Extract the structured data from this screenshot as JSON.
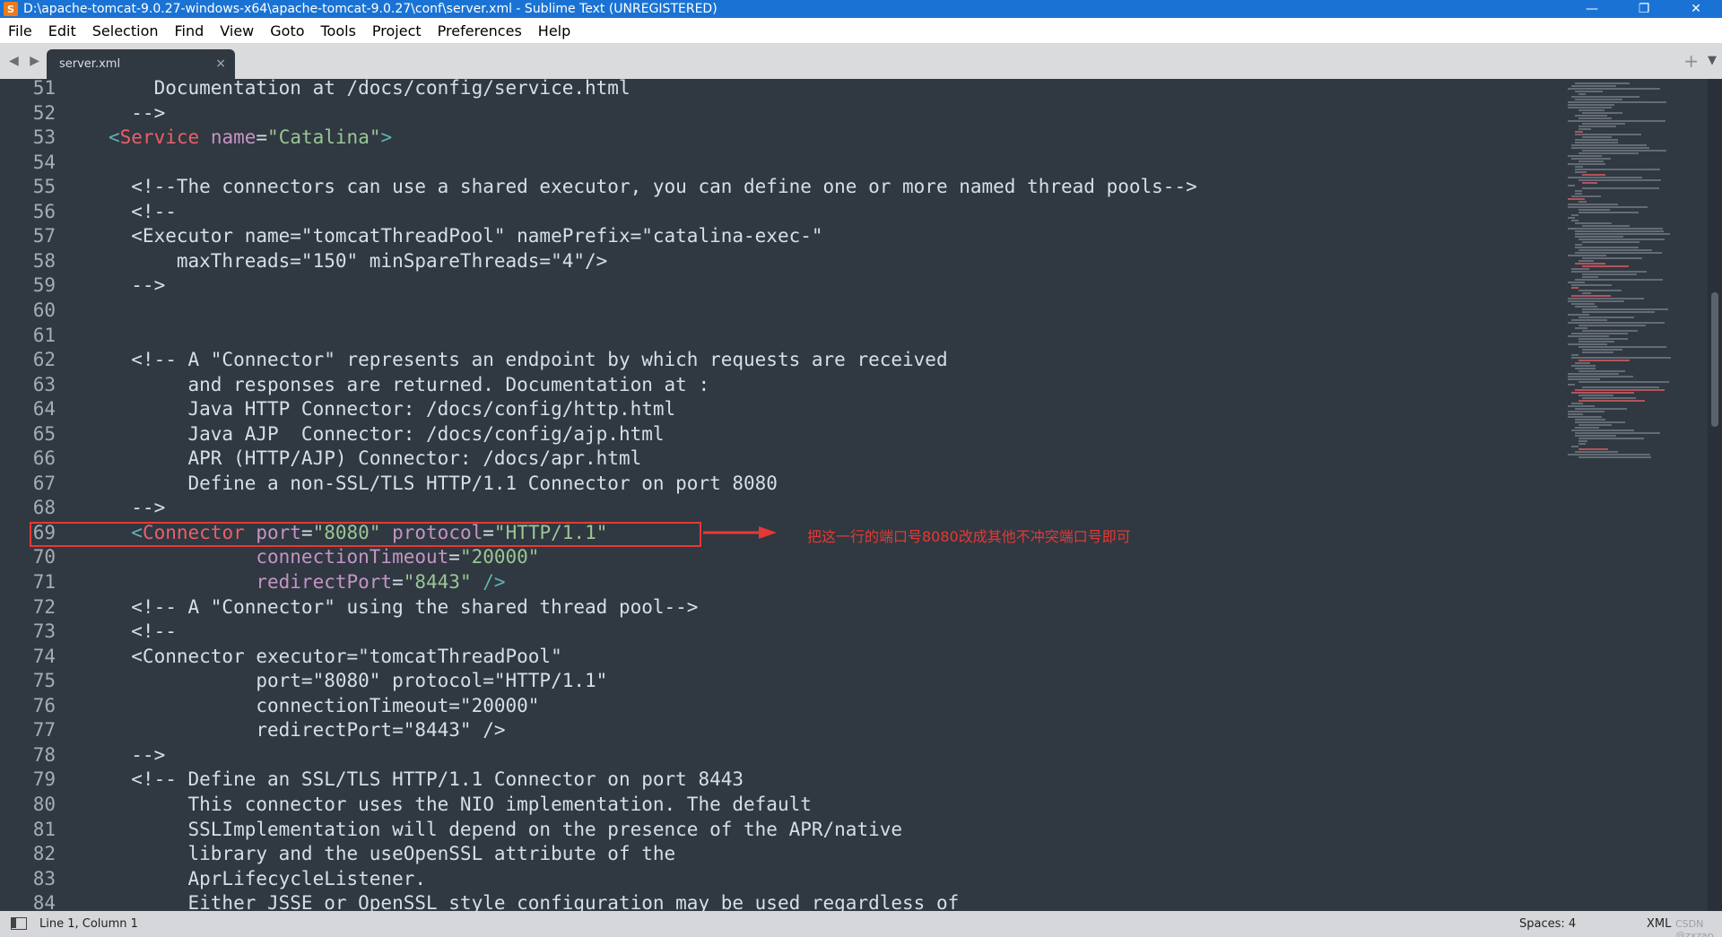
{
  "window": {
    "app_icon": "S",
    "title": "D:\\apache-tomcat-9.0.27-windows-x64\\apache-tomcat-9.0.27\\conf\\server.xml - Sublime Text (UNREGISTERED)",
    "minimize": "—",
    "restore": "❐",
    "close": "✕"
  },
  "menu": {
    "items": [
      "File",
      "Edit",
      "Selection",
      "Find",
      "View",
      "Goto",
      "Tools",
      "Project",
      "Preferences",
      "Help"
    ]
  },
  "tabs": {
    "nav": "◀ ▶",
    "active_tab": "server.xml",
    "close": "×",
    "new_tab": "+",
    "menu": "▼"
  },
  "editor": {
    "lines": [
      {
        "n": "51",
        "parts": [
          {
            "t": "    Documentation at /docs/config/service.html",
            "c": "c-comment"
          }
        ]
      },
      {
        "n": "52",
        "parts": [
          {
            "t": "  -->",
            "c": "c-comment"
          }
        ]
      },
      {
        "n": "53",
        "parts": [
          {
            "t": "<",
            "c": "c-punct"
          },
          {
            "t": "Service",
            "c": "c-tag"
          },
          {
            "t": " name",
            "c": "c-attr"
          },
          {
            "t": "=",
            "c": "c-plain"
          },
          {
            "t": "\"Catalina\"",
            "c": "c-str"
          },
          {
            "t": ">",
            "c": "c-punct"
          }
        ]
      },
      {
        "n": "54",
        "parts": [
          {
            "t": "",
            "c": "c-plain"
          }
        ]
      },
      {
        "n": "55",
        "parts": [
          {
            "t": "  <!--The connectors can use a shared executor, you can define one or more named thread pools-->",
            "c": "c-comment"
          }
        ]
      },
      {
        "n": "56",
        "parts": [
          {
            "t": "  <!--",
            "c": "c-comment"
          }
        ]
      },
      {
        "n": "57",
        "parts": [
          {
            "t": "  <Executor name=\"tomcatThreadPool\" namePrefix=\"catalina-exec-\"",
            "c": "c-comment"
          }
        ]
      },
      {
        "n": "58",
        "parts": [
          {
            "t": "      maxThreads=\"150\" minSpareThreads=\"4\"/>",
            "c": "c-comment"
          }
        ]
      },
      {
        "n": "59",
        "parts": [
          {
            "t": "  -->",
            "c": "c-comment"
          }
        ]
      },
      {
        "n": "60",
        "parts": [
          {
            "t": "",
            "c": "c-plain"
          }
        ]
      },
      {
        "n": "61",
        "parts": [
          {
            "t": "",
            "c": "c-plain"
          }
        ]
      },
      {
        "n": "62",
        "parts": [
          {
            "t": "  <!-- A \"Connector\" represents an endpoint by which requests are received",
            "c": "c-comment"
          }
        ]
      },
      {
        "n": "63",
        "parts": [
          {
            "t": "       and responses are returned. Documentation at :",
            "c": "c-comment"
          }
        ]
      },
      {
        "n": "64",
        "parts": [
          {
            "t": "       Java HTTP Connector: /docs/config/http.html",
            "c": "c-comment"
          }
        ]
      },
      {
        "n": "65",
        "parts": [
          {
            "t": "       Java AJP  Connector: /docs/config/ajp.html",
            "c": "c-comment"
          }
        ]
      },
      {
        "n": "66",
        "parts": [
          {
            "t": "       APR (HTTP/AJP) Connector: /docs/apr.html",
            "c": "c-comment"
          }
        ]
      },
      {
        "n": "67",
        "parts": [
          {
            "t": "       Define a non-SSL/TLS HTTP/1.1 Connector on port 8080",
            "c": "c-comment"
          }
        ]
      },
      {
        "n": "68",
        "parts": [
          {
            "t": "  -->",
            "c": "c-comment"
          }
        ]
      },
      {
        "n": "69",
        "parts": [
          {
            "t": "  <",
            "c": "c-punct"
          },
          {
            "t": "Connector",
            "c": "c-tag"
          },
          {
            "t": " port",
            "c": "c-attr"
          },
          {
            "t": "=",
            "c": "c-plain"
          },
          {
            "t": "\"8080\"",
            "c": "c-str"
          },
          {
            "t": " protocol",
            "c": "c-attr"
          },
          {
            "t": "=",
            "c": "c-plain"
          },
          {
            "t": "\"HTTP/1.1\"",
            "c": "c-str"
          }
        ]
      },
      {
        "n": "70",
        "parts": [
          {
            "t": "             connectionTimeout",
            "c": "c-attr"
          },
          {
            "t": "=",
            "c": "c-plain"
          },
          {
            "t": "\"20000\"",
            "c": "c-str"
          }
        ]
      },
      {
        "n": "71",
        "parts": [
          {
            "t": "             redirectPort",
            "c": "c-attr"
          },
          {
            "t": "=",
            "c": "c-plain"
          },
          {
            "t": "\"8443\"",
            "c": "c-str"
          },
          {
            "t": " />",
            "c": "c-punct"
          }
        ]
      },
      {
        "n": "72",
        "parts": [
          {
            "t": "  <!-- A \"Connector\" using the shared thread pool-->",
            "c": "c-comment"
          }
        ]
      },
      {
        "n": "73",
        "parts": [
          {
            "t": "  <!--",
            "c": "c-comment"
          }
        ]
      },
      {
        "n": "74",
        "parts": [
          {
            "t": "  <Connector executor=\"tomcatThreadPool\"",
            "c": "c-comment"
          }
        ]
      },
      {
        "n": "75",
        "parts": [
          {
            "t": "             port=\"8080\" protocol=\"HTTP/1.1\"",
            "c": "c-comment"
          }
        ]
      },
      {
        "n": "76",
        "parts": [
          {
            "t": "             connectionTimeout=\"20000\"",
            "c": "c-comment"
          }
        ]
      },
      {
        "n": "77",
        "parts": [
          {
            "t": "             redirectPort=\"8443\" />",
            "c": "c-comment"
          }
        ]
      },
      {
        "n": "78",
        "parts": [
          {
            "t": "  -->",
            "c": "c-comment"
          }
        ]
      },
      {
        "n": "79",
        "parts": [
          {
            "t": "  <!-- Define an SSL/TLS HTTP/1.1 Connector on port 8443",
            "c": "c-comment"
          }
        ]
      },
      {
        "n": "80",
        "parts": [
          {
            "t": "       This connector uses the NIO implementation. The default",
            "c": "c-comment"
          }
        ]
      },
      {
        "n": "81",
        "parts": [
          {
            "t": "       SSLImplementation will depend on the presence of the APR/native",
            "c": "c-comment"
          }
        ]
      },
      {
        "n": "82",
        "parts": [
          {
            "t": "       library and the useOpenSSL attribute of the",
            "c": "c-comment"
          }
        ]
      },
      {
        "n": "83",
        "parts": [
          {
            "t": "       AprLifecycleListener.",
            "c": "c-comment"
          }
        ]
      },
      {
        "n": "84",
        "parts": [
          {
            "t": "       Either JSSE or OpenSSL style configuration may be used regardless of",
            "c": "c-comment"
          }
        ]
      }
    ]
  },
  "annotation": {
    "text": "把这一行的端口号8080改成其他不冲突端口号即可",
    "color": "#e53935"
  },
  "status": {
    "position": "Line 1, Column 1",
    "spaces": "Spaces: 4",
    "syntax": "XML",
    "watermark": "CSDN @zxzap"
  },
  "colors": {
    "background": "#303841",
    "tag": "#ec5f67",
    "attribute": "#c594c5",
    "string": "#99c794",
    "punctuation": "#5fb3b3",
    "comment": "#d8dee9"
  }
}
